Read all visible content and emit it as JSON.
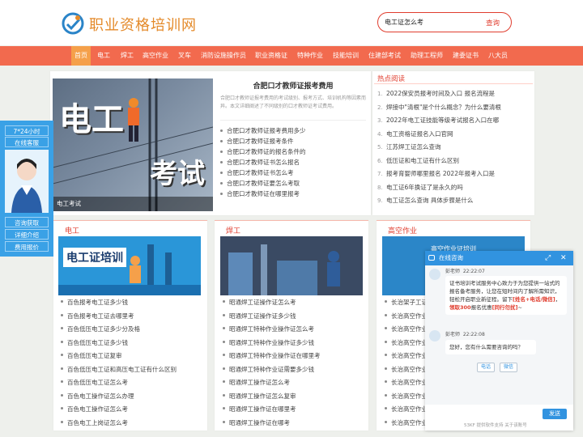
{
  "site": {
    "name": "职业资格培训网"
  },
  "search": {
    "value": "电工证怎么考",
    "button": "查询"
  },
  "nav": [
    "首页",
    "电工",
    "焊工",
    "高空作业",
    "叉车",
    "消防设施操作员",
    "职业资格证",
    "特种作业",
    "技能培训",
    "住建部考试",
    "助理工程师",
    "建委证书",
    "八大员"
  ],
  "hero": {
    "caption": "电工考试",
    "big_text": [
      "电工",
      "考试"
    ]
  },
  "article": {
    "title": "合肥口才教师证报考费用",
    "desc": "合肥口才教师证报考费用的考试级别、报考方式、培训机构等因素而异。本文详细阐述了不同级别的口才教师证考试费用。"
  },
  "article_links": [
    "合肥口才教师证报考费用多少",
    "合肥口才教师证报考条件",
    "合肥口才教师证的报名条件的",
    "合肥口才教师证书怎么报名",
    "合肥口才教师证书怎么考",
    "合肥口才教师证要怎么考取",
    "合肥口才教师证在哪里报考"
  ],
  "hot": {
    "title": "热点阅读",
    "items": [
      "2022保安员报考时间及入口 报名流程是",
      "焊接中\"清根\"是个什么概念？为什么要清根",
      "2022年电工证技能等级考试报名入口在哪",
      "电工资格证报名入口官网",
      "江苏焊工证怎么查询",
      "低压证和电工证有什么区别",
      "报考育婴师哪里报名 2022年报考入口是",
      "电工证6年换证了是永久的吗",
      "电工证怎么查询 具体步骤是什么"
    ]
  },
  "sections": [
    {
      "title": "电工",
      "thumb": "电工证培训",
      "items": [
        "百色报考电工证多少钱",
        "百色报考电工证去哪里考",
        "百色低压电工证多少分及格",
        "百色低压电工证多少钱",
        "百色低压电工证复审",
        "百色低压电工证和高压电工证有什么区别",
        "百色低压电工证怎么考",
        "百色电工操作证怎么办理",
        "百色电工操作证怎么考",
        "百色电工上岗证怎么考"
      ]
    },
    {
      "title": "焊工",
      "items": [
        "昭通焊工证操作证怎么考",
        "昭通焊工证操作证多少钱",
        "昭通焊工特种作业操作证怎么考",
        "昭通焊工特种作业操作证多少钱",
        "昭通焊工特种作业操作证在哪里考",
        "昭通焊工特种作业证需要多少钱",
        "昭通焊工操作证怎么考",
        "昭通焊工操作证怎么复审",
        "昭通焊工操作证在哪里考",
        "昭通焊工操作证在哪考"
      ]
    },
    {
      "title": "高空作业",
      "thumb": "高空作业证培训",
      "items": [
        "长治架子工证",
        "长治高空作业证",
        "长治高空作业证",
        "长治高空作业证",
        "长治高空作业证",
        "长治高空作业证",
        "长治高空作业证",
        "长治高空作业证",
        "长治高空作业证",
        "长治高空作业证"
      ]
    }
  ],
  "float": {
    "hours": "7*24小时",
    "service": "在线客服",
    "buttons": [
      "咨询获取",
      "详细介绍",
      "费用报价"
    ]
  },
  "chat": {
    "title": "在线咨询",
    "agent": "彭老师",
    "time1": "22:22:07",
    "time2": "22:22:08",
    "msg1_a": "证书培训考试服务中心致力于为您提供一站式的报名备考服务，让您在短时间内了解所需知识，轻松开启职业新征程。留下",
    "msg1_red1": "[姓名+电话/微信]",
    "msg1_b": "，",
    "msg1_red2": "领取300",
    "msg1_c": "报名优惠",
    "msg1_red3": "[同行勿扰]",
    "msg1_d": "~",
    "msg2": "您好，您有什么需要咨询的吗？",
    "opt_phone": "电话",
    "opt_wechat": "微信",
    "send": "发送",
    "powered": "53KF 提供软件支持  关于该账号"
  },
  "colors": {
    "nav": "#f26a4e",
    "accent": "#e03d2e",
    "logo": "#e48a2a",
    "chat": "#3193e0"
  }
}
